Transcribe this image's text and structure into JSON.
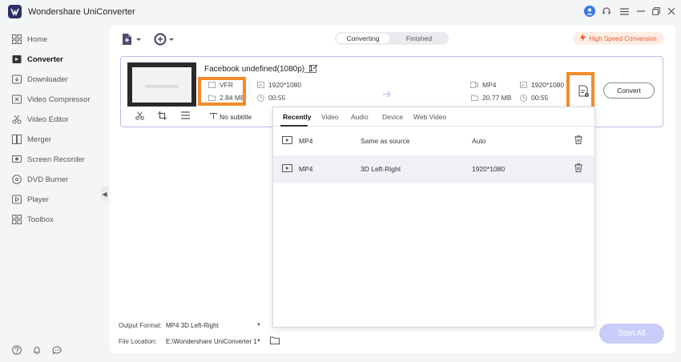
{
  "app": {
    "title": "Wondershare UniConverter"
  },
  "sidebar": {
    "items": [
      {
        "label": "Home",
        "icon": "home-icon"
      },
      {
        "label": "Converter",
        "icon": "converter-icon",
        "active": true
      },
      {
        "label": "Downloader",
        "icon": "downloader-icon"
      },
      {
        "label": "Video Compressor",
        "icon": "compressor-icon"
      },
      {
        "label": "Video Editor",
        "icon": "editor-icon"
      },
      {
        "label": "Merger",
        "icon": "merger-icon"
      },
      {
        "label": "Screen Recorder",
        "icon": "recorder-icon"
      },
      {
        "label": "DVD Burner",
        "icon": "dvd-icon"
      },
      {
        "label": "Player",
        "icon": "player-icon"
      },
      {
        "label": "Toolbox",
        "icon": "toolbox-icon"
      }
    ]
  },
  "tabs": {
    "converting": "Converting",
    "finished": "Finished"
  },
  "high_speed": "High Speed Conversion",
  "file": {
    "name": "Facebook undefined(1080p)_1",
    "source": {
      "format": "VFR",
      "resolution": "1920*1080",
      "size": "2.84 MB",
      "duration": "00:55"
    },
    "target": {
      "format": "MP4",
      "resolution": "1920*1080",
      "size": "20.77 MB",
      "duration": "00:55"
    },
    "subtitle": "No subtitle",
    "convert_label": "Convert"
  },
  "format_panel": {
    "tabs": [
      "Recently",
      "Video",
      "Audio",
      "Device",
      "Web Video"
    ],
    "rows": [
      {
        "format": "MP4",
        "quality": "Same as source",
        "resolution": "Auto"
      },
      {
        "format": "MP4",
        "quality": "3D Left-Right",
        "resolution": "1920*1080"
      }
    ]
  },
  "bottom": {
    "output_format_label": "Output Format:",
    "output_format_value": "MP4 3D Left-Right",
    "file_location_label": "File Location:",
    "file_location_value": "E:\\Wondershare UniConverter 1",
    "start_all": "Start All"
  },
  "colors": {
    "accent": "#f05a28",
    "highlight": "#f48a2a",
    "start_all_bg": "#c8cdfa",
    "card_border": "#b9bde6"
  }
}
